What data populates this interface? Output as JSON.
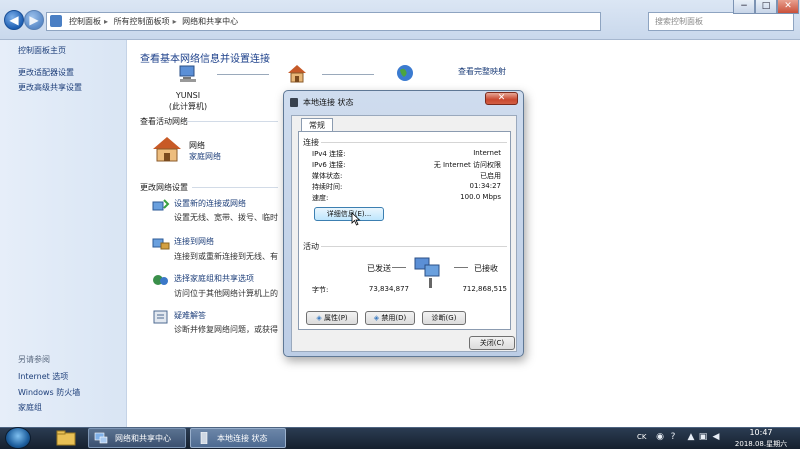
{
  "window": {
    "breadcrumb": [
      "控制面板",
      "所有控制面板项",
      "网络和共享中心"
    ],
    "search_placeholder": "搜索控制面板",
    "buttons": {
      "minimize": "−",
      "maximize": "□",
      "close": "✕"
    }
  },
  "sidebar": {
    "home": "控制面板主页",
    "items": [
      "更改适配器设置",
      "更改高级共享设置"
    ],
    "see_also_title": "另请参阅",
    "see_also": [
      "Internet 选项",
      "Windows 防火墙",
      "家庭组"
    ]
  },
  "main": {
    "title": "查看基本网络信息并设置连接",
    "full_map": "查看完整映射",
    "computer_name": "YUNSI",
    "computer_sub": "(此计算机)",
    "active_networks_title": "查看活动网络",
    "network_name": "网络",
    "network_type": "家庭网络",
    "change_settings_title": "更改网络设置",
    "tasks": [
      {
        "link": "设置新的连接或网络",
        "desc": "设置无线、宽带、拨号、临时或 VPN 连接；或设置路由器或访问点。"
      },
      {
        "link": "连接到网络",
        "desc": "连接到或重新连接到无线、有线、拨号或 VPN 网络连接。"
      },
      {
        "link": "选择家庭组和共享选项",
        "desc": "访问位于其他网络计算机上的文件和打印机，或更改共享设置。"
      },
      {
        "link": "疑难解答",
        "desc": "诊断并修复网络问题，或获得故障排除信息。"
      }
    ]
  },
  "dialog": {
    "title": "本地连接 状态",
    "close": "✕",
    "tab": "常规",
    "connection_group": "连接",
    "connection": [
      {
        "key": "IPv4 连接:",
        "value": "Internet"
      },
      {
        "key": "IPv6 连接:",
        "value": "无 Internet 访问权限"
      },
      {
        "key": "媒体状态:",
        "value": "已启用"
      },
      {
        "key": "持续时间:",
        "value": "01:34:27"
      },
      {
        "key": "速度:",
        "value": "100.0 Mbps"
      }
    ],
    "details_button": "详细信息(E)...",
    "activity_group": "活动",
    "sent_label": "已发送",
    "received_label": "已接收",
    "bytes_label": "字节:",
    "bytes_sent": "73,834,877",
    "bytes_received": "712,868,515",
    "properties_button": "属性(P)",
    "disable_button": "禁用(D)",
    "diagnose_button": "诊断(G)",
    "close_button": "关闭(C)"
  },
  "taskbar": {
    "task1": "网络和共享中心",
    "task2": "本地连接 状态",
    "lang": "CK",
    "time": "10:47",
    "date": "2018.08.星期六"
  },
  "colors": {
    "link": "#1e3f7a",
    "title": "#1b3f8a",
    "taskbar": "#16202e"
  }
}
